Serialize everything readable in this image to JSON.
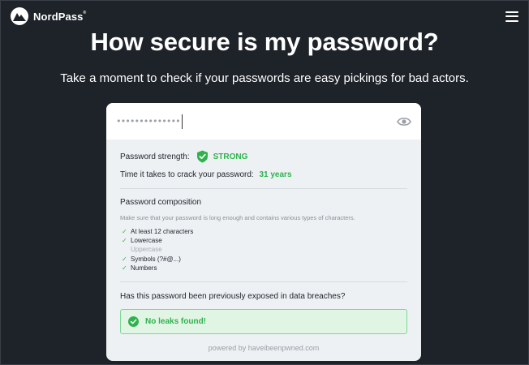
{
  "header": {
    "brand_name": "NordPass",
    "brand_mark": "®",
    "menu_icon": "hamburger-menu-icon"
  },
  "hero": {
    "title": "How secure is my password?",
    "subtitle": "Take a moment to check if your passwords are easy pickings for bad actors."
  },
  "checker": {
    "password_masked": "••••••••••••••",
    "eye_icon": "eye-icon",
    "strength_label": "Password strength:",
    "strength_value": "STRONG",
    "crack_label": "Time it takes to crack your password:",
    "crack_value": "31 years",
    "composition_title": "Password composition",
    "composition_desc": "Make sure that your password is long enough and contains various types of characters.",
    "requirements": [
      {
        "label": "At least 12 characters",
        "met": true
      },
      {
        "label": "Lowercase",
        "met": true
      },
      {
        "label": "Uppercase",
        "met": false
      },
      {
        "label": "Symbols (?#@...)",
        "met": true
      },
      {
        "label": "Numbers",
        "met": true
      }
    ],
    "breach_question": "Has this password been previously exposed in data breaches?",
    "breach_result": "No leaks found!",
    "powered_by": "powered by haveibeenpwned.com"
  },
  "colors": {
    "background": "#1e2229",
    "success": "#2fb24c",
    "card": "#eef1f4"
  }
}
